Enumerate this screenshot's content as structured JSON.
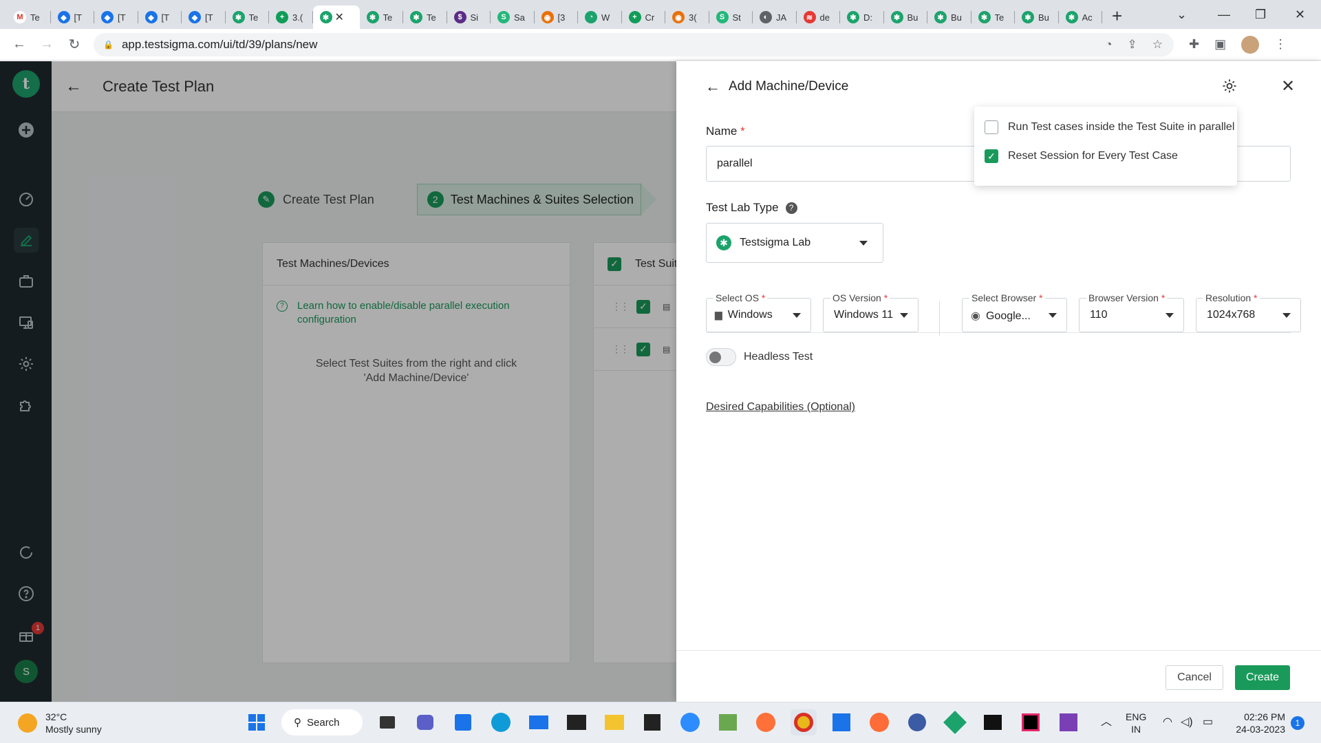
{
  "browser": {
    "tabs": [
      {
        "label": "Te",
        "color": "#ffffff",
        "glyph": "M",
        "glyph_color": "#d93025"
      },
      {
        "label": "[T",
        "color": "#1a73e8",
        "glyph": "◆"
      },
      {
        "label": "[T",
        "color": "#1a73e8",
        "glyph": "◆"
      },
      {
        "label": "[T",
        "color": "#1a73e8",
        "glyph": "◆"
      },
      {
        "label": "[T",
        "color": "#1a73e8",
        "glyph": "◆"
      },
      {
        "label": "Te",
        "color": "#1ca36c",
        "glyph": "✱"
      },
      {
        "label": "3.(",
        "color": "#0f9d58",
        "glyph": "+"
      },
      {
        "label": "",
        "color": "#1ca36c",
        "glyph": "✱",
        "active": true
      },
      {
        "label": "Te",
        "color": "#1ca36c",
        "glyph": "✱"
      },
      {
        "label": "Te",
        "color": "#1ca36c",
        "glyph": "✱"
      },
      {
        "label": "Si",
        "color": "#5b2c86",
        "glyph": "$"
      },
      {
        "label": "Sa",
        "color": "#23b77a",
        "glyph": "S"
      },
      {
        "label": "[3",
        "color": "#e8710a",
        "glyph": "◉"
      },
      {
        "label": "W",
        "color": "#1ca36c",
        "glyph": "◔"
      },
      {
        "label": "Cr",
        "color": "#0f9d58",
        "glyph": "+"
      },
      {
        "label": "3(",
        "color": "#e8710a",
        "glyph": "◉"
      },
      {
        "label": "St",
        "color": "#23b77a",
        "glyph": "S"
      },
      {
        "label": "JA",
        "color": "#5f6368",
        "glyph": "◐"
      },
      {
        "label": "de",
        "color": "#e53935",
        "glyph": "≋"
      },
      {
        "label": "D:",
        "color": "#1ca36c",
        "glyph": "✱"
      },
      {
        "label": "Bu",
        "color": "#1ca36c",
        "glyph": "✱"
      },
      {
        "label": "Bu",
        "color": "#1ca36c",
        "glyph": "✱"
      },
      {
        "label": "Te",
        "color": "#1ca36c",
        "glyph": "✱"
      },
      {
        "label": "Bu",
        "color": "#1ca36c",
        "glyph": "✱"
      },
      {
        "label": "Ac",
        "color": "#1ca36c",
        "glyph": "✱"
      }
    ],
    "url": "app.testsigma.com/ui/td/39/plans/new"
  },
  "app": {
    "page_title": "Create Test Plan",
    "steps": {
      "step1_label": "Create Test Plan",
      "step2_number": "2",
      "step2_label": "Test Machines & Suites Selection"
    },
    "machines_panel": {
      "header": "Test Machines/Devices",
      "learn_link": "Learn how to enable/disable parallel execution configuration",
      "hint": "Select Test Suites from the right and click 'Add Machine/Device'"
    },
    "suites_panel": {
      "header": "Test Suite"
    },
    "sidebar_badge": "1",
    "user_initial": "S"
  },
  "drawer": {
    "title": "Add Machine/Device",
    "name_label": "Name",
    "name_value": "parallel",
    "lab_type_label": "Test Lab Type",
    "lab_type_value": "Testsigma Lab",
    "selects": [
      {
        "label": "Select OS",
        "value": "Windows"
      },
      {
        "label": "OS Version",
        "value": "Windows 11"
      },
      {
        "label": "Select Browser",
        "value": "Google..."
      },
      {
        "label": "Browser Version",
        "value": "110"
      },
      {
        "label": "Resolution",
        "value": "1024x768"
      }
    ],
    "headless_label": "Headless Test",
    "headless_enabled": false,
    "capabilities_link": "Desired Capabilities (Optional)",
    "cancel_label": "Cancel",
    "create_label": "Create",
    "settings_popover": {
      "option1": "Run Test cases inside the Test Suite in parallel",
      "option1_checked": false,
      "option2": "Reset Session for Every Test Case",
      "option2_checked": true
    }
  },
  "taskbar": {
    "temperature": "32°C",
    "weather": "Mostly sunny",
    "search_label": "Search",
    "lang_line1": "ENG",
    "lang_line2": "IN",
    "time": "02:26 PM",
    "date": "24-03-2023",
    "notification_count": "1"
  },
  "colors": {
    "accent": "#1a9a5a",
    "sidebar": "#1f2a2e",
    "required": "#e53935"
  }
}
